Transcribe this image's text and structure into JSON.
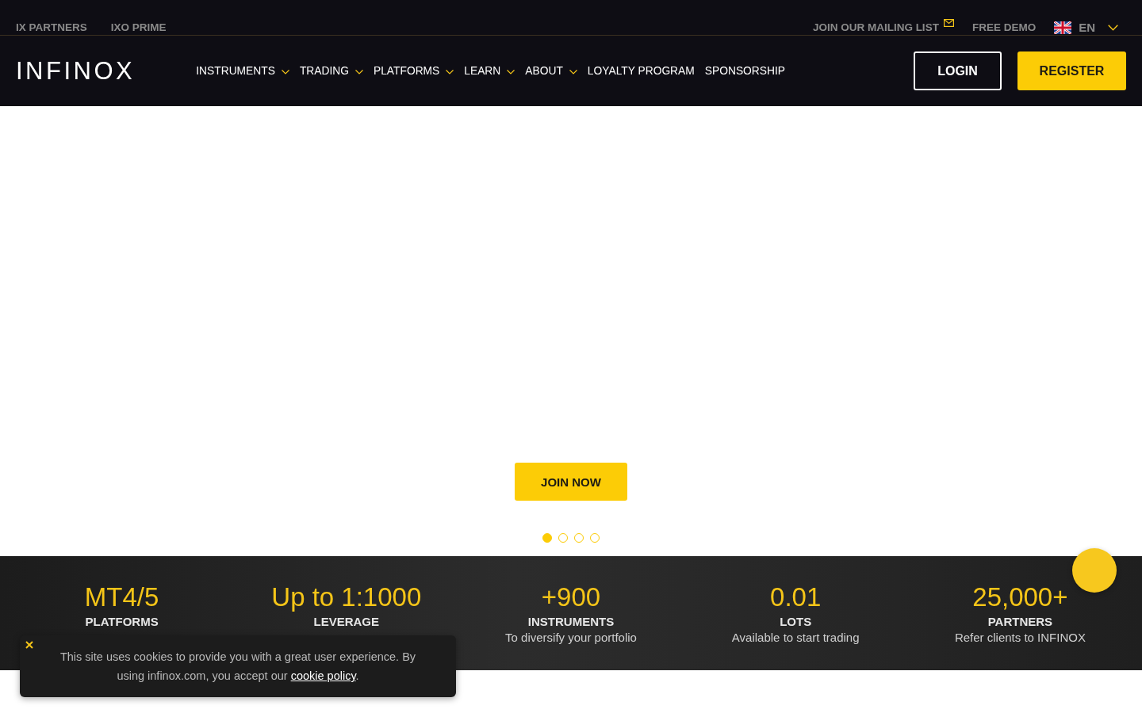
{
  "top_bar": {
    "links": [
      {
        "label": "IX PARTNERS"
      },
      {
        "label": "IXO PRIME"
      }
    ],
    "mailing_list": {
      "label": "JOIN OUR MAILING LIST"
    },
    "free_demo": {
      "label": "FREE DEMO"
    },
    "language": {
      "label": "EN"
    }
  },
  "header": {
    "logo": "INFINOX",
    "nav": [
      {
        "label": "INSTRUMENTS",
        "has_dropdown": true
      },
      {
        "label": "TRADING",
        "has_dropdown": true
      },
      {
        "label": "PLATFORMS",
        "has_dropdown": true
      },
      {
        "label": "LEARN",
        "has_dropdown": true
      },
      {
        "label": "ABOUT",
        "has_dropdown": true
      },
      {
        "label": "LOYALTY PROGRAM",
        "has_dropdown": false
      },
      {
        "label": "SPONSORSHIP",
        "has_dropdown": false
      }
    ],
    "login": "LOGIN",
    "register": "REGISTER"
  },
  "hero": {
    "cta": "JOIN NOW",
    "slides": [
      {
        "selected": true
      },
      {
        "selected": false
      },
      {
        "selected": false
      },
      {
        "selected": false
      }
    ]
  },
  "stats": [
    {
      "value": "MT4/5",
      "label": "PLATFORMS"
    },
    {
      "value": "Up to 1:1000",
      "label": "LEVERAGE"
    },
    {
      "value": "+900",
      "label": "INSTRUMENTS",
      "description": "To diversify your portfolio"
    },
    {
      "value": "0.01",
      "label": "LOTS",
      "description": "Available to start trading"
    },
    {
      "value": "25,000+",
      "label": "PARTNERS",
      "description": "Refer clients to INFINOX"
    }
  ],
  "cookie_banner": {
    "text": "This site uses cookies to provide you with a great user experience. By using infinox.com, you accept our",
    "link": "cookie policy",
    "text_after": "."
  }
}
